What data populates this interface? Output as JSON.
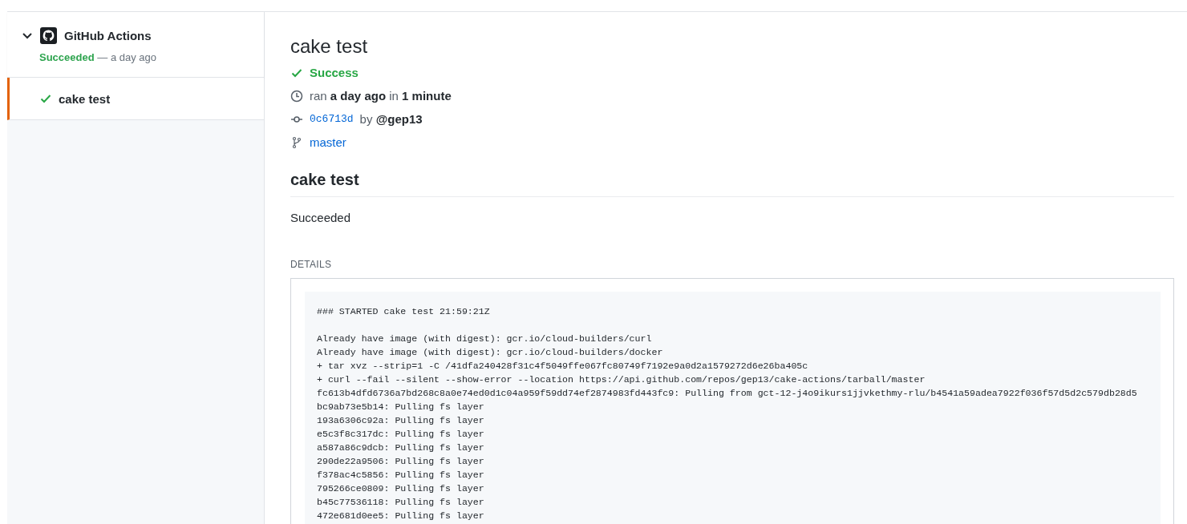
{
  "sidebar": {
    "app": {
      "name": "GitHub Actions",
      "expanded": true,
      "status": "Succeeded",
      "time": "— a day ago"
    },
    "checks": [
      {
        "name": "cake test",
        "kind": "success",
        "selected": true
      }
    ]
  },
  "run": {
    "title": "cake test",
    "status": {
      "kind": "success",
      "label": "Success"
    },
    "ran": "ran **a day ago** in **1 minute**",
    "commit": {
      "sha": "0c6713d",
      "author": "by **@gep13**"
    },
    "branch": "master"
  },
  "output": {
    "title": "cake test",
    "summary": "Succeeded",
    "details_label": "DETAILS",
    "log": [
      [
        "### STARTED cake test 21:59:21Z"
      ],
      [
        "Already have image (with digest): gcr.io/cloud-builders/curl",
        "Already have image (with digest): gcr.io/cloud-builders/docker",
        "+ tar xvz --strip=1 -C /41dfa240428f31c4f5049ffe067fc80749f7192e9a0d2a1579272d6e26ba405c",
        "+ curl --fail --silent --show-error --location https://api.github.com/repos/gep13/cake-actions/tarball/master",
        "fc613b4dfd6736a7bd268c8a0e74ed0d1c04a959f59dd74ef2874983fd443fc9: Pulling from gct-12-j4o9ikurs1jjvkethmy-rlu/b4541a59adea7922f036f57d5d2c579db28d5",
        "bc9ab73e5b14: Pulling fs layer",
        "193a6306c92a: Pulling fs layer",
        "e5c3f8c317dc: Pulling fs layer",
        "a587a86c9dcb: Pulling fs layer",
        "290de22a9506: Pulling fs layer",
        "f378ac4c5856: Pulling fs layer",
        "795266ce0809: Pulling fs layer",
        "b45c77536118: Pulling fs layer",
        "472e681d0ee5: Pulling fs layer"
      ]
    ]
  }
}
